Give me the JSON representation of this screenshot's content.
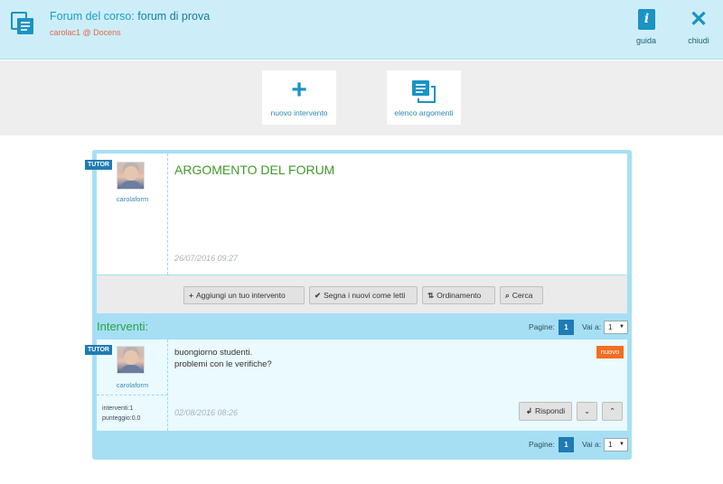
{
  "header": {
    "title_prefix": "Forum del corso: ",
    "title_name": "forum di prova",
    "user": "carolac1 @ Docens",
    "guida_label": "guida",
    "chiudi_label": "chiudi"
  },
  "toolbar": {
    "nuovo_label": "nuovo intervento",
    "elenco_label": "elenco argomenti"
  },
  "topic": {
    "role": "TUTOR",
    "author": "carolaform",
    "title": "ARGOMENTO DEL FORUM",
    "date": "26/07/2016 09:27"
  },
  "actions": {
    "add": "Aggiungi un tuo intervento",
    "mark_read": "Segna i nuovi come letti",
    "sort": "Ordinamento",
    "search": "Cerca"
  },
  "interventi": {
    "title": "Interventi:",
    "pages_label": "Pagine:",
    "page": "1",
    "goto_label": "Vai a:",
    "goto_value": "1"
  },
  "post": {
    "role": "TUTOR",
    "author": "carolaform",
    "interventi": "interventi:1",
    "punteggio": "punteggio:0.0",
    "line1": "buongiorno studenti.",
    "line2": "problemi con le verifiche?",
    "badge": "nuovo",
    "date": "02/08/2016 08:26",
    "reply": "Rispondi"
  },
  "colors": {
    "accent": "#1b93c4",
    "header_bg": "#cdeef9",
    "panel_bg": "#a6dff4",
    "badge_new": "#f36d21",
    "tutor_badge": "#1f7bb5"
  }
}
